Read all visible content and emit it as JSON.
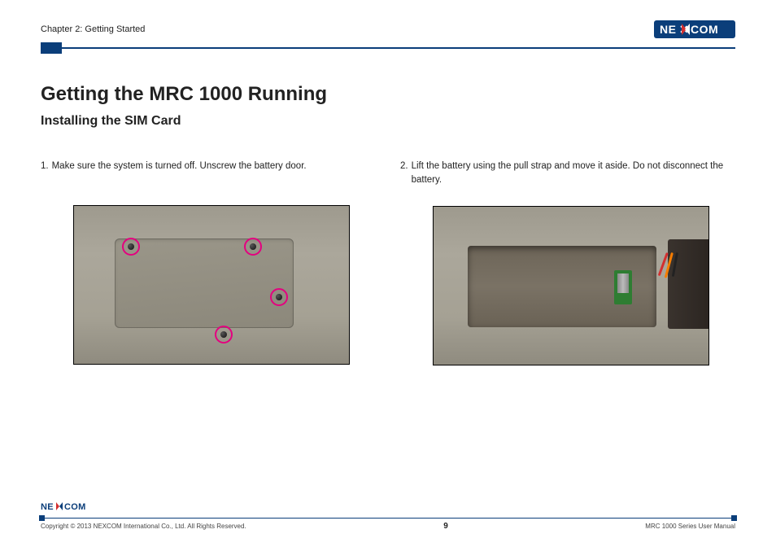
{
  "header": {
    "chapter": "Chapter 2: Getting Started",
    "brand": "NEXCOM"
  },
  "content": {
    "title": "Getting the MRC 1000 Running",
    "section": "Installing the SIM Card",
    "steps": [
      {
        "num": "1.",
        "text": "Make sure the system is turned off. Unscrew the battery door."
      },
      {
        "num": "2.",
        "text": "Lift the battery using the pull strap and move it aside. Do not disconnect the battery."
      }
    ]
  },
  "footer": {
    "copyright": "Copyright © 2013 NEXCOM International Co., Ltd. All Rights Reserved.",
    "page": "9",
    "manual": "MRC 1000 Series User Manual"
  },
  "colors": {
    "brand_blue": "#0b3e7a",
    "accent_magenta": "#e4007f"
  }
}
